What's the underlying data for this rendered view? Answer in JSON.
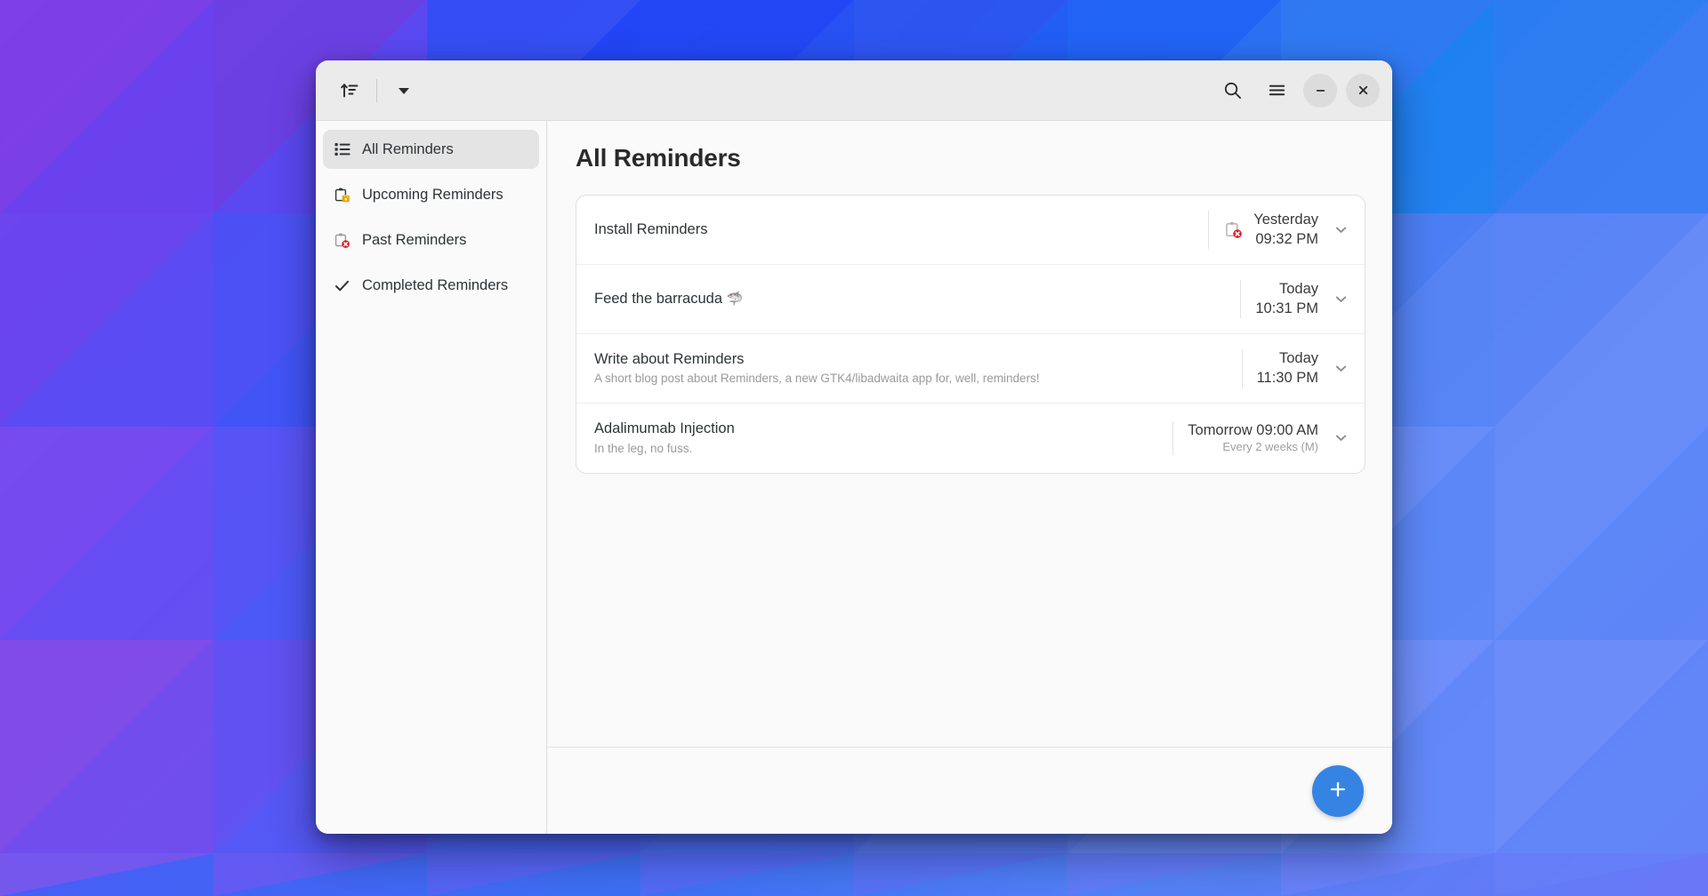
{
  "window": {
    "header": {
      "sort_icon": "sort-ascending-icon",
      "dropdown_icon": "chevron-down-icon",
      "search_icon": "search-icon",
      "menu_icon": "hamburger-menu-icon",
      "minimize_label": "–",
      "close_label": "✕"
    }
  },
  "sidebar": {
    "items": [
      {
        "label": "All Reminders",
        "icon": "list-bullet-icon",
        "selected": true
      },
      {
        "label": "Upcoming Reminders",
        "icon": "clipboard-upcoming-icon",
        "selected": false
      },
      {
        "label": "Past Reminders",
        "icon": "clipboard-past-icon",
        "selected": false
      },
      {
        "label": "Completed Reminders",
        "icon": "checkmark-icon",
        "selected": false
      }
    ]
  },
  "main": {
    "title": "All Reminders",
    "reminders": [
      {
        "title": "Install Reminders",
        "subtitle": "",
        "emoji": "",
        "date_icon": "clipboard-past-icon",
        "date_line1": "Yesterday",
        "date_line2": "09:32 PM",
        "date_line2_muted": false,
        "chevron": "chevron-down-icon"
      },
      {
        "title": "Feed the barracuda",
        "subtitle": "",
        "emoji": "🦈",
        "date_icon": "",
        "date_line1": "Today",
        "date_line2": "10:31 PM",
        "date_line2_muted": false,
        "chevron": "chevron-down-icon"
      },
      {
        "title": "Write about Reminders",
        "subtitle": "A short blog post about Reminders, a new GTK4/libadwaita app for, well, reminders!",
        "emoji": "",
        "date_icon": "",
        "date_line1": "Today",
        "date_line2": "11:30 PM",
        "date_line2_muted": false,
        "chevron": "chevron-down-icon"
      },
      {
        "title": "Adalimumab Injection",
        "subtitle": "In the leg, no fuss.",
        "emoji": "",
        "date_icon": "",
        "date_line1": "Tomorrow 09:00 AM",
        "date_line2": "Every 2 weeks (M)",
        "date_line2_muted": true,
        "chevron": "chevron-down-icon"
      }
    ]
  },
  "actionbar": {
    "add_label": "+",
    "add_icon": "plus-icon"
  },
  "colors": {
    "accent": "#3584e4",
    "headerbar": "#ebebeb",
    "window_bg": "#fafafa",
    "card_bg": "#ffffff",
    "selected_row": "#e4e4e4",
    "past_badge": "#e01b24",
    "upcoming_badge": "#e5a50a"
  }
}
